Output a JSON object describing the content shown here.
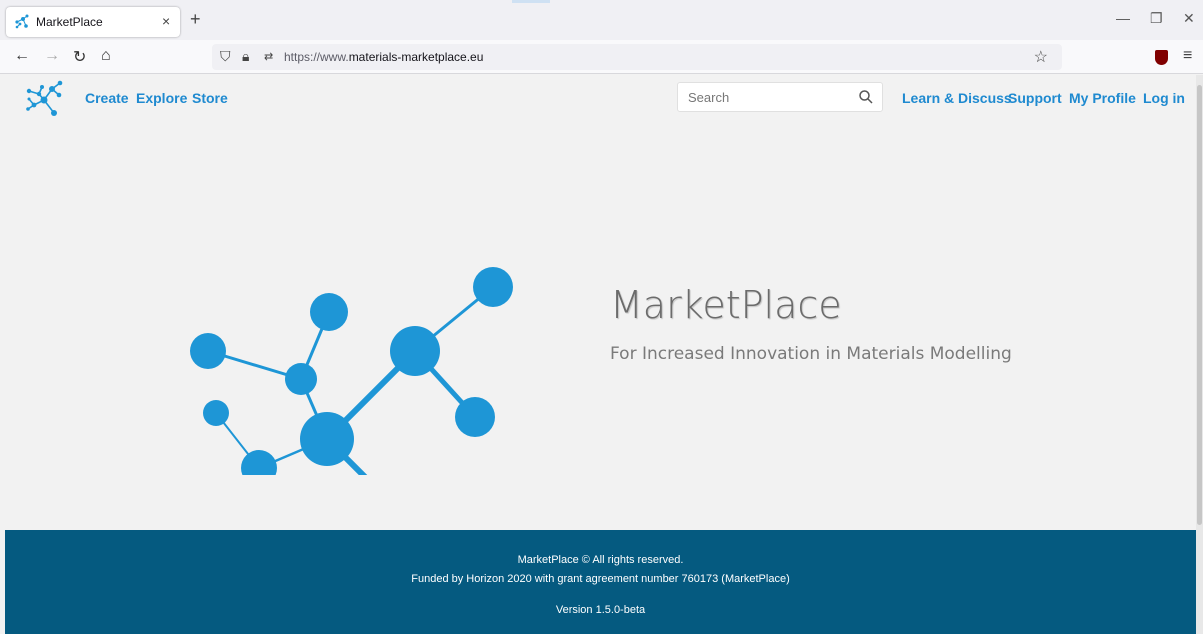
{
  "browser": {
    "tab_title": "MarketPlace",
    "tab_close": "×",
    "new_tab": "+",
    "url_prefix": "https://www.",
    "url_domain": "materials-marketplace.eu",
    "window_controls": [
      "—",
      "❐",
      "✕"
    ]
  },
  "site": {
    "nav": [
      "Create",
      "Explore",
      "Store"
    ],
    "nav_right": [
      "Learn & Discuss",
      "Support",
      "My Profile",
      "Log in"
    ],
    "search": {
      "placeholder": "Search",
      "value": ""
    }
  },
  "hero": {
    "title": "MarketPlace",
    "subtitle": "For Increased Innovation in Materials Modelling"
  },
  "footer": {
    "copyright": "MarketPlace © All rights reserved.",
    "funding": "Funded by Horizon 2020 with grant agreement number 760173 (MarketPlace)",
    "version": "Version 1.5.0-beta"
  },
  "colors": {
    "link": "#1f8ad0",
    "node": "#1e96d6",
    "footer_bg": "#055a80"
  }
}
